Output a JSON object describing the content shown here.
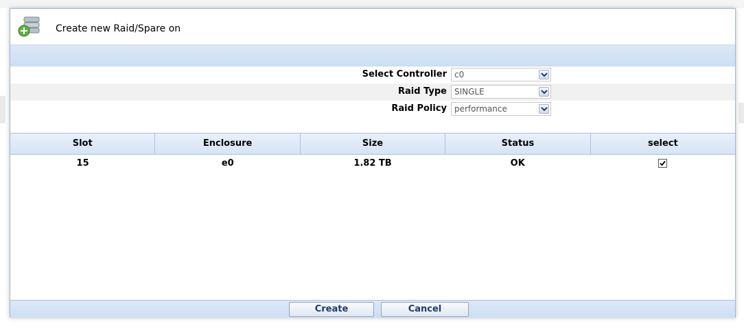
{
  "dialog": {
    "title": "Create new Raid/Spare on",
    "icon": "disk-add-icon"
  },
  "form": {
    "controller": {
      "label": "Select Controller",
      "value": "c0"
    },
    "raid_type": {
      "label": "Raid Type",
      "value": "SINGLE"
    },
    "raid_policy": {
      "label": "Raid Policy",
      "value": "performance"
    }
  },
  "table": {
    "columns": [
      "Slot",
      "Enclosure",
      "Size",
      "Status",
      "select"
    ],
    "rows": [
      {
        "slot": "15",
        "enclosure": "e0",
        "size": "1.82 TB",
        "status": "OK",
        "selected": true
      }
    ]
  },
  "buttons": {
    "create": "Create",
    "cancel": "Cancel"
  },
  "colors": {
    "header_blue": "#d6e4f4",
    "border_blue": "#aac1dd",
    "button_text": "#1f3c68"
  }
}
